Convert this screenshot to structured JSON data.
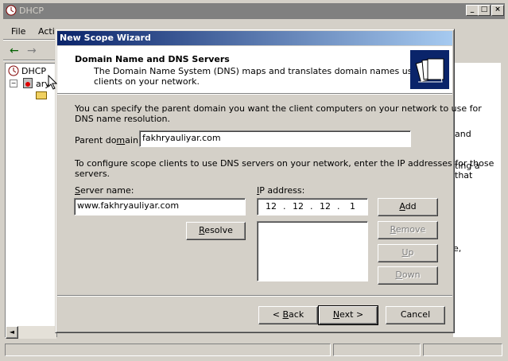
{
  "bg_window": {
    "title": "DHCP",
    "menu": [
      "File",
      "Actic"
    ],
    "tree": {
      "root": "DHCP",
      "child": "ary"
    },
    "right_text": [
      "and",
      "ting a",
      "that",
      "e,"
    ]
  },
  "dialog": {
    "title": "New Scope Wizard",
    "header_title": "Domain Name and DNS Servers",
    "header_desc_1": "The Domain Name System (DNS) maps and translates domain names used by",
    "header_desc_2": "clients on your network.",
    "intro_1": "You can specify the parent domain you want the client computers on your network to use for",
    "intro_2": "DNS name resolution.",
    "parent_domain_label_pre": "Parent do",
    "parent_domain_label_key": "m",
    "parent_domain_label_post": "ain:",
    "parent_domain_value": "fakhryauliyar.com",
    "dns_text_1": "To configure scope clients to use DNS servers on your network, enter the IP addresses for those",
    "dns_text_2": "servers.",
    "server_name_label_key": "S",
    "server_name_label_post": "erver name:",
    "server_name_value": "www.fakhryauliyar.com",
    "ip_label_key": "I",
    "ip_label_post": "P address:",
    "ip_octets": [
      "12",
      "12",
      "12",
      "1"
    ],
    "buttons": {
      "add_key": "A",
      "add_post": "dd",
      "resolve_key": "R",
      "resolve_post": "esolve",
      "remove_key": "R",
      "remove_post": "emove",
      "up_key": "U",
      "up_post": "p",
      "down_key": "D",
      "down_post": "own",
      "back_pre": "< ",
      "back_key": "B",
      "back_post": "ack",
      "next_key": "N",
      "next_post": "ext >",
      "cancel": "Cancel"
    }
  },
  "colors": {
    "titlebar_active": "#0a246a",
    "face": "#d4d0c8"
  }
}
